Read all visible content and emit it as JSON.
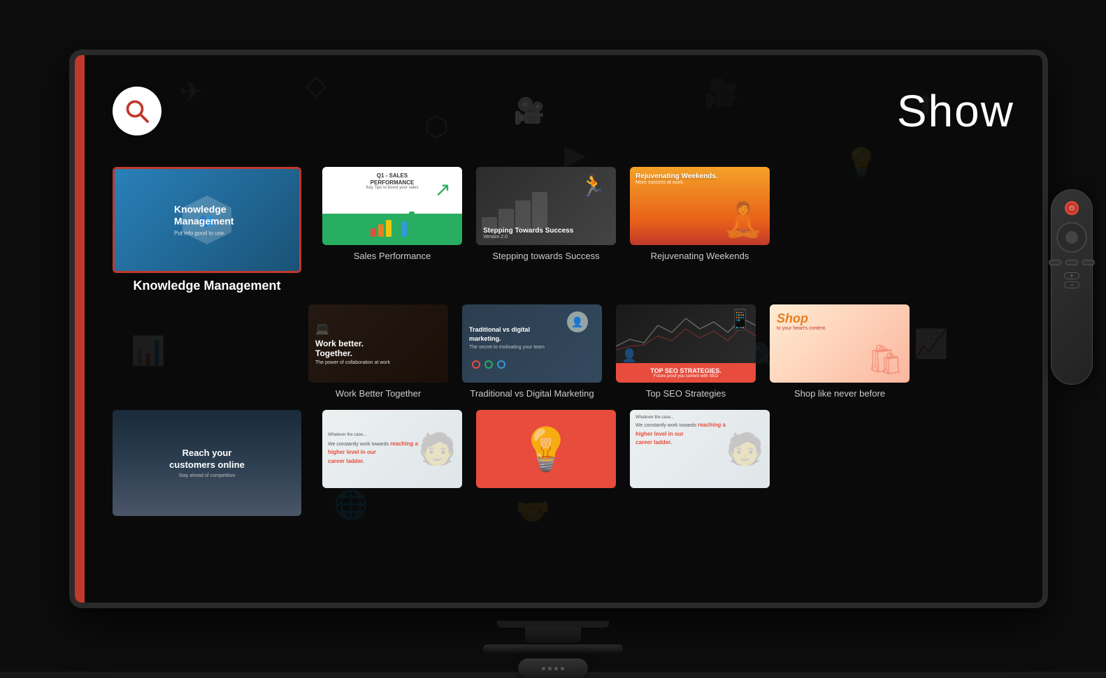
{
  "header": {
    "title": "Show",
    "search_label": "Search"
  },
  "items": [
    {
      "id": "knowledge-management",
      "label": "Knowledge Management",
      "featured": true,
      "thumb_type": "km",
      "thumb_title": "Knowledge Management",
      "thumb_sub": "Put info good to use."
    },
    {
      "id": "sales-performance",
      "label": "Sales Performance",
      "featured": false,
      "thumb_type": "sales",
      "thumb_title": "Q1 - SALES PERFORMANCE",
      "thumb_sub": "Key Tips to boost your sales"
    },
    {
      "id": "stepping-towards-success",
      "label": "Stepping towards Success",
      "featured": false,
      "thumb_type": "steps",
      "thumb_title": "Stepping Towards Success",
      "thumb_sub": "Version 2.0"
    },
    {
      "id": "rejuvenating-weekends",
      "label": "Rejuvenating Weekends",
      "featured": false,
      "thumb_type": "rejuv",
      "thumb_title": "Rejuvenating Weekends.",
      "thumb_sub": "More success at work."
    },
    {
      "id": "work-better-together",
      "label": "Work Better Together",
      "featured": false,
      "thumb_type": "work",
      "thumb_title": "Work better. Together.",
      "thumb_sub": "The power of collaboration at work"
    },
    {
      "id": "traditional-vs-digital",
      "label": "Traditional vs Digital Marketing",
      "featured": false,
      "thumb_type": "trad",
      "thumb_title": "Traditional vs digital marketing.",
      "thumb_sub": "The secret to motivating your team"
    },
    {
      "id": "top-seo-strategies",
      "label": "Top SEO Strategies",
      "featured": false,
      "thumb_type": "seo",
      "thumb_title": "TOP SEO STRATEGIES.",
      "thumb_sub": "Future proof you content with SEO"
    },
    {
      "id": "shop-like-never-before",
      "label": "Shop like never before",
      "featured": false,
      "thumb_type": "shop",
      "thumb_title": "Shop",
      "thumb_sub": "to your heart's content."
    },
    {
      "id": "reach-customers-online",
      "label": "Reach your customers online",
      "featured": false,
      "thumb_type": "reach",
      "thumb_title": "Reach your customers online",
      "thumb_sub": "Stay ahead of competition"
    },
    {
      "id": "career-ladder-1",
      "label": "",
      "featured": false,
      "thumb_type": "career",
      "thumb_title": "We constantly work towards reaching a higher level in our career ladder.",
      "thumb_sub": "Whatever the case..."
    },
    {
      "id": "red-bulb",
      "label": "",
      "featured": false,
      "thumb_type": "bulb",
      "thumb_title": "",
      "thumb_sub": ""
    },
    {
      "id": "career-ladder-2",
      "label": "",
      "featured": false,
      "thumb_type": "career2",
      "thumb_title": "We constantly work towards reaching a higher level in our career ladder.",
      "thumb_sub": "Whatever the case..."
    }
  ]
}
